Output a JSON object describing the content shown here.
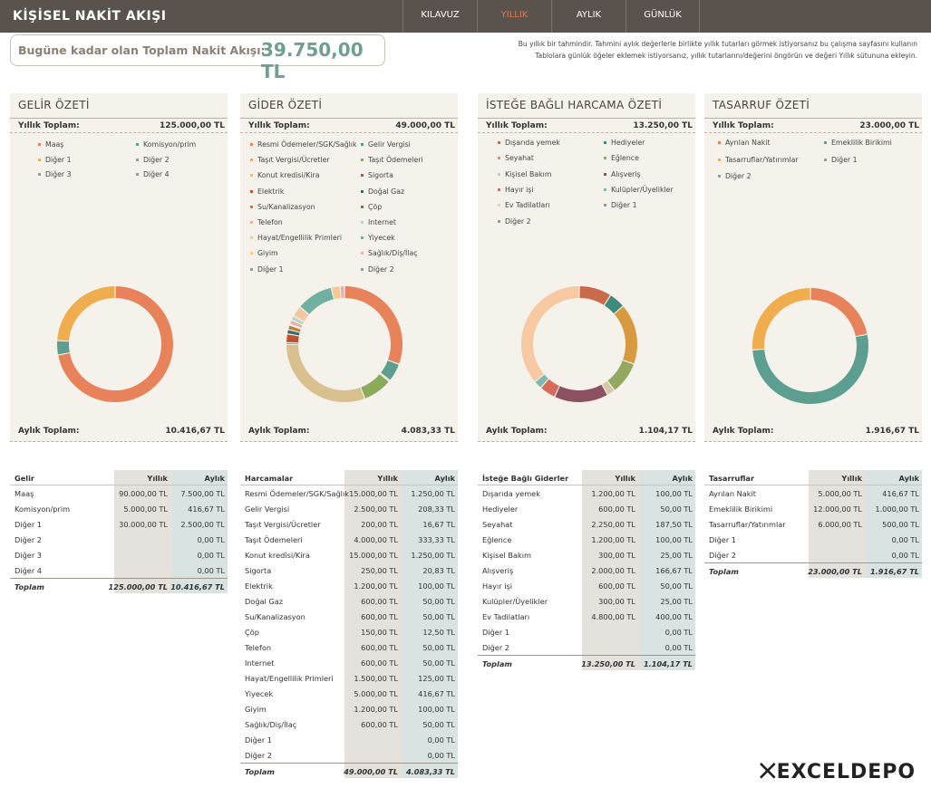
{
  "app": {
    "title": "KİŞİSEL NAKİT AKIŞI"
  },
  "nav": {
    "tabs": [
      "KILAVUZ",
      "YILLIK",
      "AYLIK",
      "GÜNLÜK"
    ],
    "active": "YILLIK",
    "active_color": "#e07a4f"
  },
  "summary": {
    "label": "Bugüne kadar olan Toplam Nakit Akışı:",
    "value": "39.750,00 TL"
  },
  "note": {
    "line1": "Bu yıllık bir tahmindir.  Tahmini aylık değerlerle birlikte yıllık tutarları görmek istiyorsanız bu çalışma sayfasını kullanın",
    "line2": "Tablolara günlük öğeler eklemek istiyorsanız, yıllık tutarlarını/değerini öngörün ve değeri Yıllık sütununa ekleyin."
  },
  "common": {
    "yearly_label": "Yıllık Toplam:",
    "monthly_label": "Aylık Toplam:",
    "col_year": "Yıllık",
    "col_month": "Aylık",
    "total_label": "Toplam"
  },
  "panels": [
    {
      "title": "GELİR ÖZETİ",
      "yearly_total": "125.000,00 TL",
      "monthly_total": "10.416,67 TL",
      "legend": [
        "Maaş",
        "Komisyon/prim",
        "Diğer 1",
        "Diğer 2",
        "Diğer 3",
        "Diğer 4"
      ]
    },
    {
      "title": "GİDER ÖZETİ",
      "yearly_total": "49.000,00 TL",
      "monthly_total": "4.083,33 TL",
      "legend": [
        "Resmi Ödemeler/SGK/Sağlık",
        "Gelir Vergisi",
        "Taşıt Vergisi/Ücretler",
        "Taşıt Ödemeleri",
        "Konut kredisi/Kira",
        "Sigorta",
        "Elektrik",
        "Doğal Gaz",
        "Su/Kanalizasyon",
        "Çöp",
        "Telefon",
        "Internet",
        "Hayat/Engellilik Primleri",
        "Yiyecek",
        "Giyim",
        "Sağlık/Diş/İlaç",
        "Diğer 1",
        "Diğer 2"
      ]
    },
    {
      "title": "İSTEĞE BAĞLI HARCAMA ÖZETİ",
      "yearly_total": "13.250,00 TL",
      "monthly_total": "1.104,17 TL",
      "legend": [
        "Dışarıda yemek",
        "Hediyeler",
        "Seyahat",
        "Eğlence",
        "Kişisel Bakım",
        "Alışveriş",
        "Hayır işi",
        "Kulüpler/Üyelikler",
        "Ev Tadilatları",
        "Diğer 1",
        "Diğer 2"
      ]
    },
    {
      "title": "TASARRUF ÖZETİ",
      "yearly_total": "23.000,00 TL",
      "monthly_total": "1.916,67 TL",
      "legend": [
        "Ayrılan Nakit",
        "Emeklilik Birikimi",
        "Tasarruflar/Yatırımlar",
        "Diğer 1",
        "Diğer 2"
      ]
    }
  ],
  "tables": [
    {
      "header": "Gelir",
      "total_year": "125.000,00 TL",
      "total_month": "10.416,67 TL",
      "rows": [
        [
          "Maaş",
          "90.000,00 TL",
          "7.500,00 TL"
        ],
        [
          "Komisyon/prim",
          "5.000,00 TL",
          "416,67 TL"
        ],
        [
          "Diğer 1",
          "30.000,00 TL",
          "2.500,00 TL"
        ],
        [
          "Diğer 2",
          "",
          "0,00 TL"
        ],
        [
          "Diğer 3",
          "",
          "0,00 TL"
        ],
        [
          "Diğer 4",
          "",
          "0,00 TL"
        ]
      ]
    },
    {
      "header": "Harcamalar",
      "total_year": "49.000,00 TL",
      "total_month": "4.083,33 TL",
      "rows": [
        [
          "Resmi Ödemeler/SGK/Sağlık",
          "15.000,00 TL",
          "1.250,00 TL"
        ],
        [
          "Gelir Vergisi",
          "2.500,00 TL",
          "208,33 TL"
        ],
        [
          "Taşıt Vergisi/Ücretler",
          "200,00 TL",
          "16,67 TL"
        ],
        [
          "Taşıt Ödemeleri",
          "4.000,00 TL",
          "333,33 TL"
        ],
        [
          "Konut kredisi/Kira",
          "15.000,00 TL",
          "1.250,00 TL"
        ],
        [
          "Sigorta",
          "250,00 TL",
          "20,83 TL"
        ],
        [
          "Elektrik",
          "1.200,00 TL",
          "100,00 TL"
        ],
        [
          "Doğal Gaz",
          "600,00 TL",
          "50,00 TL"
        ],
        [
          "Su/Kanalizasyon",
          "600,00 TL",
          "50,00 TL"
        ],
        [
          "Çöp",
          "150,00 TL",
          "12,50 TL"
        ],
        [
          "Telefon",
          "600,00 TL",
          "50,00 TL"
        ],
        [
          "Internet",
          "600,00 TL",
          "50,00 TL"
        ],
        [
          "Hayat/Engellilik Primleri",
          "1.500,00 TL",
          "125,00 TL"
        ],
        [
          "Yiyecek",
          "5.000,00 TL",
          "416,67 TL"
        ],
        [
          "Giyim",
          "1.200,00 TL",
          "100,00 TL"
        ],
        [
          "Sağlık/Diş/İlaç",
          "600,00 TL",
          "50,00 TL"
        ],
        [
          "Diğer 1",
          "",
          "0,00 TL"
        ],
        [
          "Diğer 2",
          "",
          "0,00 TL"
        ]
      ]
    },
    {
      "header": "İsteğe Bağlı Giderler",
      "total_year": "13.250,00 TL",
      "total_month": "1.104,17 TL",
      "rows": [
        [
          "Dışarıda yemek",
          "1.200,00 TL",
          "100,00 TL"
        ],
        [
          "Hediyeler",
          "600,00 TL",
          "50,00 TL"
        ],
        [
          "Seyahat",
          "2.250,00 TL",
          "187,50 TL"
        ],
        [
          "Eğlence",
          "1.200,00 TL",
          "100,00 TL"
        ],
        [
          "Kişisel Bakım",
          "300,00 TL",
          "25,00 TL"
        ],
        [
          "Alışveriş",
          "2.000,00 TL",
          "166,67 TL"
        ],
        [
          "Hayır işi",
          "600,00 TL",
          "50,00 TL"
        ],
        [
          "Kulüpler/Üyelikler",
          "300,00 TL",
          "25,00 TL"
        ],
        [
          "Ev Tadilatları",
          "4.800,00 TL",
          "400,00 TL"
        ],
        [
          "Diğer 1",
          "",
          "0,00 TL"
        ],
        [
          "Diğer 2",
          "",
          "0,00 TL"
        ]
      ]
    },
    {
      "header": "Tasarruflar",
      "total_year": "23.000,00 TL",
      "total_month": "1.916,67 TL",
      "rows": [
        [
          "Ayrılan Nakit",
          "5.000,00 TL",
          "416,67 TL"
        ],
        [
          "Emeklilik Birikimi",
          "12.000,00 TL",
          "1.000,00 TL"
        ],
        [
          "Tasarruflar/Yatırımlar",
          "6.000,00 TL",
          "500,00 TL"
        ],
        [
          "Diğer 1",
          "",
          "0,00 TL"
        ],
        [
          "Diğer 2",
          "",
          "0,00 TL"
        ]
      ]
    }
  ],
  "chart_data": [
    {
      "type": "pie",
      "categories": [
        "Maaş",
        "Komisyon/prim",
        "Diğer 1"
      ],
      "values": [
        90000,
        5000,
        30000
      ],
      "colors": [
        "#e8825a",
        "#5c9e8f",
        "#f0ad4e"
      ]
    },
    {
      "type": "pie",
      "categories": [
        "Resmi Ödemeler/SGK/Sağlık",
        "Gelir Vergisi",
        "Taşıt Vergisi/Ücretler",
        "Taşıt Ödemeleri",
        "Konut kredisi/Kira",
        "Sigorta",
        "Elektrik",
        "Doğal Gaz",
        "Su/Kanalizasyon",
        "Çöp",
        "Telefon",
        "Internet",
        "Hayat/Engellilik Primleri",
        "Yiyecek",
        "Giyim",
        "Sağlık/Diş/İlaç"
      ],
      "values": [
        15000,
        2500,
        200,
        4000,
        15000,
        250,
        1200,
        600,
        600,
        150,
        600,
        600,
        1500,
        5000,
        1200,
        600
      ],
      "colors": [
        "#e8825a",
        "#5c9e8f",
        "#f0ad4e",
        "#8aab5a",
        "#d9c08f",
        "#a05a6a",
        "#c05030",
        "#3a6e64",
        "#c07c3a",
        "#6a7a3a",
        "#e6b3a0",
        "#b8d4cc",
        "#f2c8a0",
        "#6fb0a0",
        "#f7c98f",
        "#d7b6b8"
      ]
    },
    {
      "type": "pie",
      "categories": [
        "Dışarıda yemek",
        "Hediyeler",
        "Seyahat",
        "Eğlence",
        "Kişisel Bakım",
        "Alışveriş",
        "Hayır işi",
        "Kulüpler/Üyelikler",
        "Ev Tadilatları"
      ],
      "values": [
        1200,
        600,
        2250,
        1200,
        300,
        2000,
        600,
        300,
        4800
      ],
      "colors": [
        "#c96b4a",
        "#3f8a7a",
        "#d89a3f",
        "#93a860",
        "#d8c9a6",
        "#8c5060",
        "#d76b5a",
        "#7fb8ad",
        "#f6c9a2"
      ]
    },
    {
      "type": "pie",
      "categories": [
        "Ayrılan Nakit",
        "Emeklilik Birikimi",
        "Tasarruflar/Yatırımlar"
      ],
      "values": [
        5000,
        12000,
        6000
      ],
      "colors": [
        "#e8825a",
        "#5c9e8f",
        "#f0ad4e"
      ]
    }
  ],
  "brand": {
    "text": "EXCELDEPO"
  }
}
